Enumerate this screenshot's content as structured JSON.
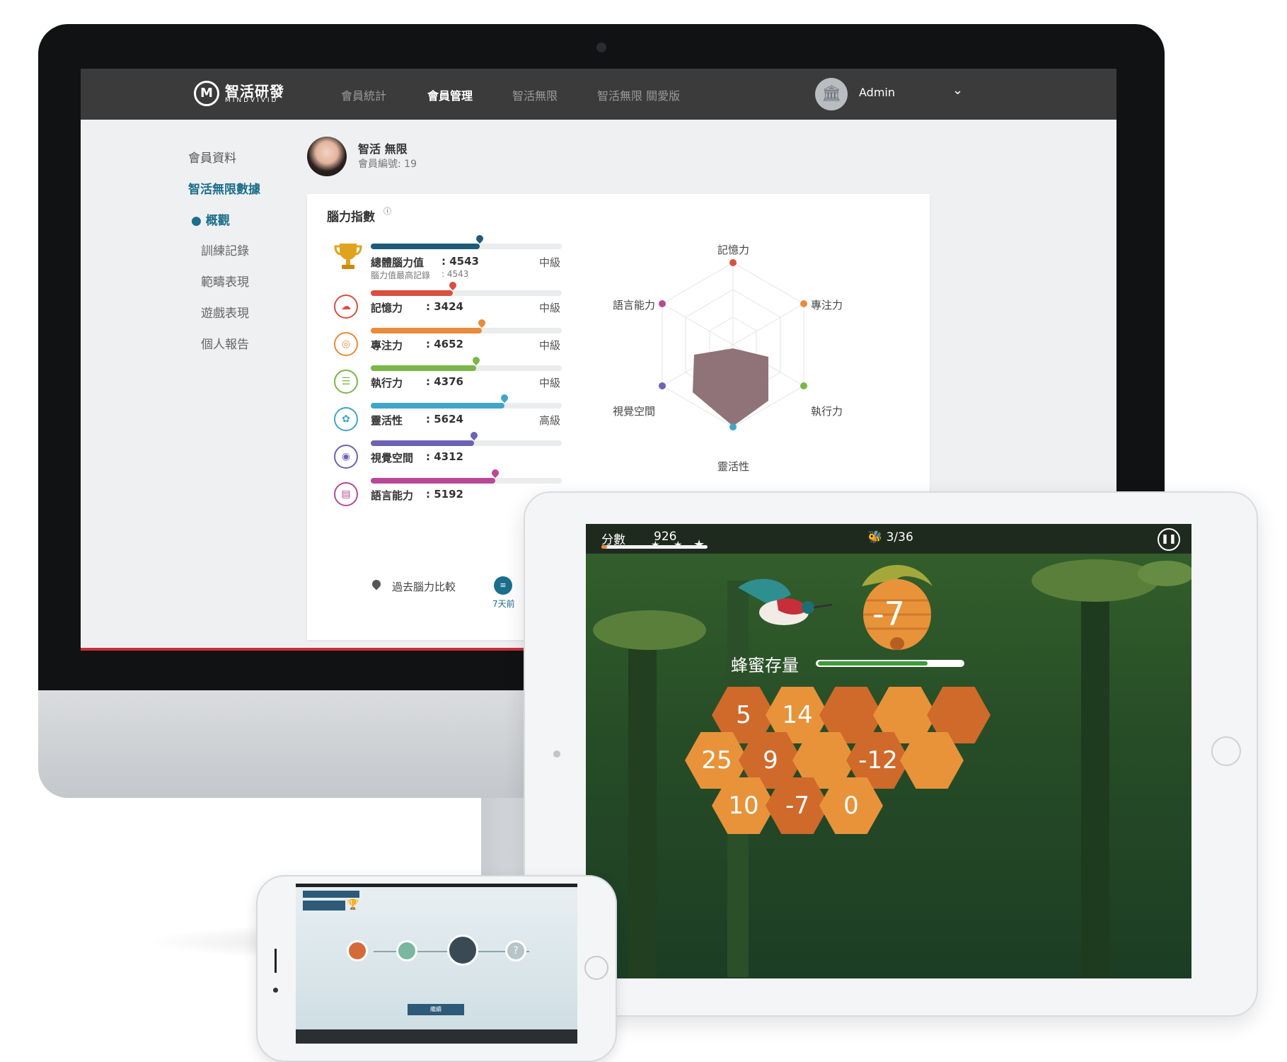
{
  "logo": {
    "mark": "M",
    "name": "智活研發",
    "sub": "MINDVIVID"
  },
  "nav": [
    {
      "label": "會員統計",
      "active": false
    },
    {
      "label": "會員管理",
      "active": true
    },
    {
      "label": "智活無限",
      "active": false
    },
    {
      "label": "智活無限 關愛版",
      "active": false
    }
  ],
  "user": {
    "name": "Admin",
    "avatar_icon": "bank-icon"
  },
  "sidebar": {
    "items": [
      {
        "label": "會員資料"
      },
      {
        "label": "智活無限數據"
      }
    ],
    "subitems": [
      {
        "label": "● 概觀",
        "active": true
      },
      {
        "label": "訓練記錄"
      },
      {
        "label": "範疇表現"
      },
      {
        "label": "遊戲表現"
      },
      {
        "label": "個人報告"
      }
    ]
  },
  "profile": {
    "name": "智活 無限",
    "member_id": "會員編號: 19"
  },
  "brain": {
    "title": "腦力指數",
    "overall": {
      "label": "總體腦力值",
      "value": ": 4543",
      "level": "中級",
      "record_label": "腦力值最高記錄",
      "record_value": ": 4543",
      "fill": 0.57,
      "color": "#1f5b78"
    },
    "stats": [
      {
        "label": "記憶力",
        "value": ": 3424",
        "level": "中級",
        "fill": 0.43,
        "color": "#d9503f",
        "icon": "brain-icon"
      },
      {
        "label": "專注力",
        "value": ": 4652",
        "level": "中級",
        "fill": 0.58,
        "color": "#e98b3a",
        "icon": "target-icon"
      },
      {
        "label": "執行力",
        "value": ": 4376",
        "level": "中級",
        "fill": 0.55,
        "color": "#7ab648",
        "icon": "checklist-icon"
      },
      {
        "label": "靈活性",
        "value": ": 5624",
        "level": "高級",
        "fill": 0.7,
        "color": "#3fa6c9",
        "icon": "flower-icon"
      },
      {
        "label": "視覺空間",
        "value": ": 4312",
        "level": "",
        "fill": 0.54,
        "color": "#6c63b5",
        "icon": "eye-icon"
      },
      {
        "label": "語言能力",
        "value": ": 5192",
        "level": "",
        "fill": 0.65,
        "color": "#b8489a",
        "icon": "speech-icon"
      }
    ],
    "radar_labels": [
      "記憶力",
      "專注力",
      "執行力",
      "靈活性",
      "視覺空間",
      "語言能力"
    ],
    "compare_label": "過去腦力比較",
    "compare_time": "7天前"
  },
  "game": {
    "score_label": "分數",
    "score": "926",
    "score_progress": 0.05,
    "count": "3/36",
    "pause_icon": "pause-icon",
    "hive_value": "-7",
    "honey_label": "蜂蜜存量",
    "honey_level": 0.76,
    "hexes": [
      "5",
      "14",
      "",
      "",
      "",
      "25",
      "9",
      "",
      "-12",
      "",
      "10",
      "-7",
      "0"
    ]
  },
  "phone": {
    "continue": "繼續",
    "mystery": "?"
  },
  "colors": {
    "nav_bg": "#3b3b3c",
    "accent": "#1b6e8c",
    "honey": "#e8933a",
    "honey_dark": "#cf6a2b"
  }
}
